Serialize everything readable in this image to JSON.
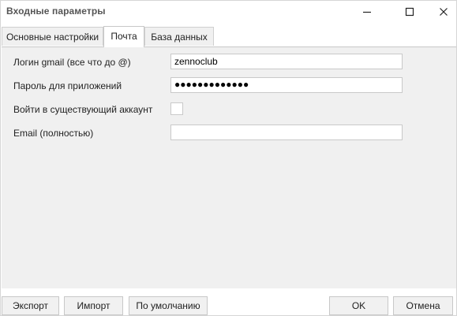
{
  "window": {
    "title": "Входные параметры",
    "controls": {
      "minimize": "minimize",
      "maximize": "maximize",
      "close": "close"
    }
  },
  "tabs": [
    {
      "label": "Основные настройки",
      "active": false
    },
    {
      "label": "Почта",
      "active": true
    },
    {
      "label": "База данных",
      "active": false
    }
  ],
  "form": {
    "login_label": "Логин gmail (все что до @)",
    "login_value": "zennoclub",
    "password_label": "Пароль для приложений",
    "password_value": "●●●●●●●●●●●●●",
    "login_existing_label": "Войти в существующий аккаунт",
    "login_existing_checked": false,
    "email_label": "Email (полностью)",
    "email_value": ""
  },
  "buttons": {
    "export": "Экспорт",
    "import": "Импорт",
    "defaults": "По умолчанию",
    "ok": "OK",
    "cancel": "Отмена"
  },
  "colors": {
    "panel_bg": "#f0f0f0",
    "border": "#c8c8c8",
    "title_text": "#555555"
  }
}
